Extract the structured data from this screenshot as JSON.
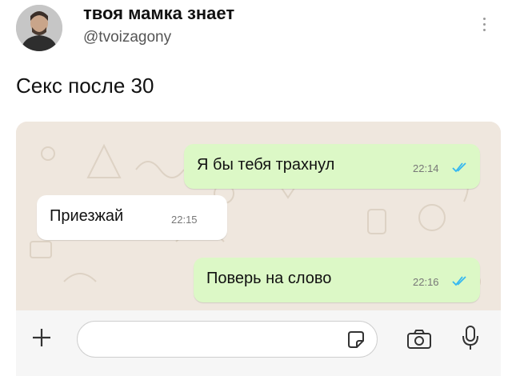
{
  "author": {
    "display_name": "твоя мамка знает",
    "handle": "@tvoizagony"
  },
  "tweet": {
    "text": "Секс после 30"
  },
  "chat": {
    "messages": [
      {
        "direction": "outgoing",
        "text": "Я бы тебя трахнул",
        "time": "22:14",
        "read": true
      },
      {
        "direction": "incoming",
        "text": "Приезжай",
        "time": "22:15"
      },
      {
        "direction": "outgoing",
        "text": "Поверь на слово",
        "time": "22:16",
        "read": true
      }
    ],
    "composer": {
      "icons": [
        "plus-icon",
        "sticker-icon",
        "camera-icon",
        "microphone-icon"
      ],
      "input_value": ""
    },
    "colors": {
      "outgoing_bubble": "#dcf8c6",
      "incoming_bubble": "#ffffff",
      "read_ticks": "#34b7f1",
      "wallpaper": "#efe7de"
    }
  }
}
